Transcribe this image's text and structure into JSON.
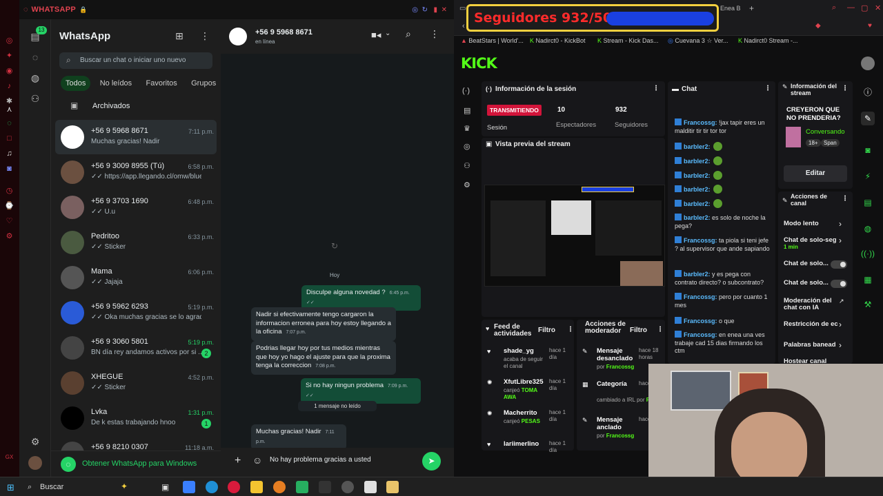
{
  "wa": {
    "window_label": "WHATSAPP",
    "title": "WhatsApp",
    "unread_count": "13",
    "search_placeholder": "Buscar un chat o iniciar uno nuevo",
    "filters": [
      "Todos",
      "No leídos",
      "Favoritos",
      "Grupos"
    ],
    "archived": "Archivados",
    "chats": [
      {
        "name": "+56 9 5968 8671",
        "time": "7:11 p.m.",
        "preview": "Muchas gracias! Nadir",
        "color": "#ffffff"
      },
      {
        "name": "+56 9 3009 8955 (Tú)",
        "time": "6:58 p.m.",
        "preview": "✓✓ https://app.llegando.cl/omw/blue...",
        "color": "#6b5040"
      },
      {
        "name": "+56 9 3703 1690",
        "time": "6:48 p.m.",
        "preview": "✓✓ U.u",
        "color": "#7a6060"
      },
      {
        "name": "Pedritoo",
        "time": "6:33 p.m.",
        "preview": "✓✓ Sticker",
        "color": "#4a5a40"
      },
      {
        "name": "Mama",
        "time": "6:06 p.m.",
        "preview": "✓✓ Jajaja",
        "color": "#555555"
      },
      {
        "name": "+56 9 5962 6293",
        "time": "5:19 p.m.",
        "preview": "✓✓ Oka muchas gracias se lo agradezco",
        "color": "#2a5bd7"
      },
      {
        "name": "+56 9 3060 5801",
        "time": "5:19 p.m.",
        "preview": "BN día rey andamos activos por si ...",
        "color": "#444444",
        "badge": "2"
      },
      {
        "name": "XHEGUE",
        "time": "4:52 p.m.",
        "preview": "✓✓ Sticker",
        "color": "#5a4030"
      },
      {
        "name": "Lvka",
        "time": "1:31 p.m.",
        "preview": "De k estas trabajando hnoo",
        "color": "#000000",
        "badge": "1"
      },
      {
        "name": "+56 9 8210 0307",
        "time": "11:18 a.m.",
        "preview": "",
        "color": "#444444"
      }
    ],
    "get_windows": "Obtener WhatsApp para Windows",
    "contact_name": "+56 9 5968 8671",
    "contact_status": "en línea",
    "day_label": "Hoy",
    "unread_label": "1 mensaje no leído",
    "messages": [
      {
        "dir": "out",
        "text": "Disculpe alguna novedad ?",
        "time": "6:45 p.m. ✓✓"
      },
      {
        "dir": "in",
        "text": "Nadir si efectivamente tengo cargaron la informacion erronea para hoy estoy llegando a la oficina",
        "time": "7:07 p.m."
      },
      {
        "dir": "in",
        "text": "Podrias llegar hoy por tus medios mientras que hoy yo hago el ajuste para que la proxima tenga la correccion",
        "time": "7:08 p.m."
      },
      {
        "dir": "out",
        "text": "Si no hay ningun problema",
        "time": "7:09 p.m. ✓✓"
      },
      {
        "dir": "in",
        "text": "Muchas gracias! Nadir",
        "time": "7:11 p.m."
      }
    ],
    "composer_text": "No hay problema gracias a usted"
  },
  "browser": {
    "tabs": [
      "BeatStars | World'...",
      "Nadirct0 - KickBot",
      "Stream - Kick Das...",
      "Cuevana 3 ☆ Ver...",
      "Nadirct0 Stream -..."
    ],
    "tab_right": "Enea B"
  },
  "overlay": {
    "followers": "Seguidores 932/500",
    "progress": 1.0
  },
  "kick": {
    "logo": "KICK",
    "session_title": "Información de la sesión",
    "live_badge": "TRANSMITIENDO",
    "session_label": "Sesión",
    "viewers": "10",
    "viewers_label": "Espectadores",
    "followers": "932",
    "followers_label": "Seguidores",
    "preview_title": "Vista previa del stream",
    "chat_title": "Chat",
    "chat_lines": [
      {
        "user": "Francossg:",
        "text": " !jax tapir eres un malditir tir tir tor tor"
      },
      {
        "user": "barbler2:",
        "text": "",
        "gem": true
      },
      {
        "user": "barbler2:",
        "text": "",
        "gem": true
      },
      {
        "user": "barbler2:",
        "text": "",
        "gem": true
      },
      {
        "user": "barbler2:",
        "text": "",
        "gem": true
      },
      {
        "user": "barbler2:",
        "text": "",
        "gem": true
      },
      {
        "user": "barbler2:",
        "text": " es solo de noche la pega?"
      },
      {
        "user": "Francossg:",
        "text": " ta piola si teni jefe ? al supervisor que ande sapiando"
      },
      {
        "user": "barbler2:",
        "text": " y es pega con contrato directo? o subcontrato?"
      },
      {
        "user": "Francossg:",
        "text": " pero por cuanto 1 mes"
      },
      {
        "user": "Francossg:",
        "text": " o que"
      },
      {
        "user": "Francossg:",
        "text": " en enea una ves trabaje cad 15 dias firmando los ctm"
      }
    ],
    "stream_info_title": "Información del stream",
    "stream_title": "CREYERON QUE NO PRENDERIA?",
    "category": "Conversando",
    "tag1": "18+",
    "tag2": "Span",
    "edit_button": "Editar",
    "actions_title": "Acciones de canal",
    "actions": [
      {
        "label": "Modo lento",
        "kind": "arrow"
      },
      {
        "label": "Chat de solo-seg",
        "sub": "1 min",
        "kind": "arrow"
      },
      {
        "label": "Chat de solo...",
        "kind": "toggle"
      },
      {
        "label": "Chat de solo...",
        "kind": "toggle"
      },
      {
        "label": "Moderación del chat con IA",
        "kind": "ext"
      },
      {
        "label": "Restricción de ec",
        "kind": "arrow"
      },
      {
        "label": "Palabras banead",
        "kind": "arrow"
      },
      {
        "label": "Hostear canal",
        "kind": "none"
      }
    ],
    "feed_title": "Feed de actividades",
    "filter": "Filtro",
    "feed": [
      {
        "user": "shade_yg",
        "time": "hace 1 día",
        "desc": "acaba de seguir el canal",
        "hl": ""
      },
      {
        "user": "XfutLibre325",
        "time": "hace 1 día",
        "desc": "canjeó ",
        "hl": "TOMA AWA"
      },
      {
        "user": "Macherrito",
        "time": "hace 1 día",
        "desc": "canjeó ",
        "hl": "PESAS"
      },
      {
        "user": "lariimerlino",
        "time": "hace 1 día",
        "desc": "",
        "hl": ""
      }
    ],
    "mod_title": "Acciones de moderador",
    "mod": [
      {
        "title": "Mensaje desanclado",
        "by": "por ",
        "who": "Francossg",
        "time": "hace 18 horas"
      },
      {
        "title": "Categoría",
        "by": "cambiado a IRL por ",
        "who": "Francossg",
        "time": "hace"
      },
      {
        "title": "Mensaje anclado",
        "by": "por ",
        "who": "Francossg",
        "time": "hace"
      }
    ]
  },
  "taskbar": {
    "search": "Buscar"
  }
}
